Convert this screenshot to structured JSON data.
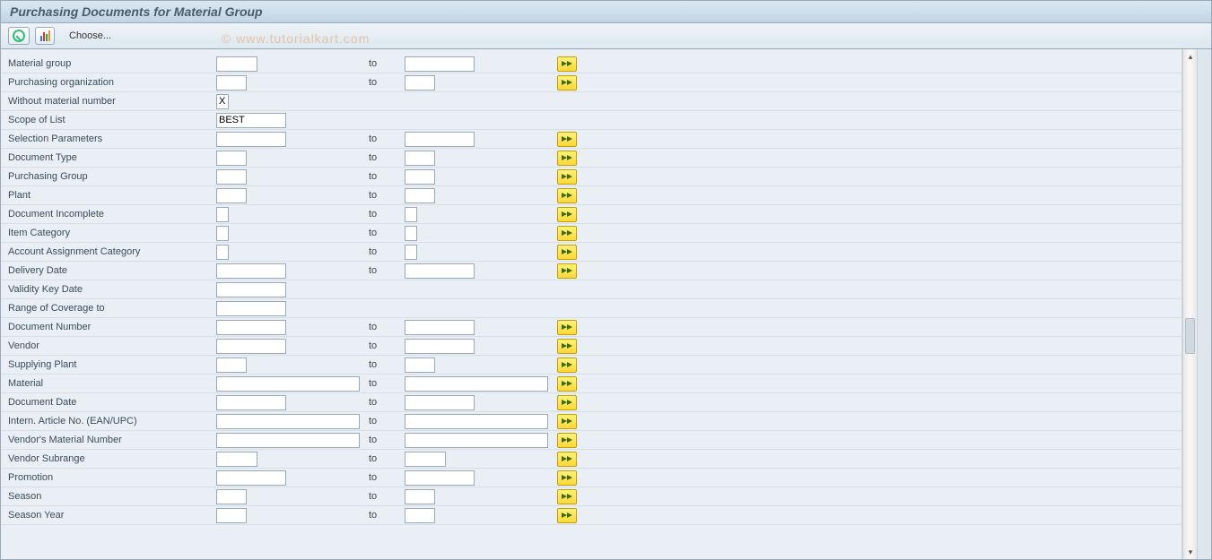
{
  "title": "Purchasing Documents for Material Group",
  "watermark": "© www.tutorialkart.com",
  "toolbar": {
    "choose": "Choose..."
  },
  "to": "to",
  "fields": [
    {
      "id": "material-group",
      "label": "Material group",
      "from_w": "s2",
      "to_w": "md",
      "multi": true,
      "val": ""
    },
    {
      "id": "purch-org",
      "label": "Purchasing organization",
      "from_w": "sm",
      "to_w": "sm",
      "multi": true,
      "val": ""
    },
    {
      "id": "without-mat-no",
      "label": "Without material number",
      "from_w": "xs",
      "to_w": "",
      "multi": false,
      "val": "X"
    },
    {
      "id": "scope-of-list",
      "label": "Scope of List",
      "from_w": "md",
      "to_w": "",
      "multi": false,
      "val": "BEST"
    },
    {
      "id": "selection-params",
      "label": "Selection Parameters",
      "from_w": "md",
      "to_w": "md",
      "multi": true,
      "val": ""
    },
    {
      "id": "doc-type",
      "label": "Document Type",
      "from_w": "sm",
      "to_w": "sm",
      "multi": true,
      "val": ""
    },
    {
      "id": "purch-group",
      "label": "Purchasing Group",
      "from_w": "sm",
      "to_w": "sm",
      "multi": true,
      "val": ""
    },
    {
      "id": "plant",
      "label": "Plant",
      "from_w": "sm",
      "to_w": "sm",
      "multi": true,
      "val": ""
    },
    {
      "id": "doc-incomplete",
      "label": "Document Incomplete",
      "from_w": "xs",
      "to_w": "xs",
      "multi": true,
      "val": ""
    },
    {
      "id": "item-category",
      "label": "Item Category",
      "from_w": "xs",
      "to_w": "xs",
      "multi": true,
      "val": ""
    },
    {
      "id": "acct-assign-cat",
      "label": "Account Assignment Category",
      "from_w": "xs",
      "to_w": "xs",
      "multi": true,
      "val": ""
    },
    {
      "id": "delivery-date",
      "label": "Delivery Date",
      "from_w": "md",
      "to_w": "md",
      "multi": true,
      "val": ""
    },
    {
      "id": "validity-key-date",
      "label": "Validity Key Date",
      "from_w": "md",
      "to_w": "",
      "multi": false,
      "val": ""
    },
    {
      "id": "range-coverage-to",
      "label": "Range of Coverage to",
      "from_w": "md",
      "to_w": "",
      "multi": false,
      "val": ""
    },
    {
      "id": "doc-number",
      "label": "Document Number",
      "from_w": "md",
      "to_w": "md",
      "multi": true,
      "val": ""
    },
    {
      "id": "vendor",
      "label": "Vendor",
      "from_w": "md",
      "to_w": "md",
      "multi": true,
      "val": ""
    },
    {
      "id": "supplying-plant",
      "label": "Supplying Plant",
      "from_w": "sm",
      "to_w": "sm",
      "multi": true,
      "val": ""
    },
    {
      "id": "material",
      "label": "Material",
      "from_w": "lg",
      "to_w": "lg",
      "multi": true,
      "val": ""
    },
    {
      "id": "doc-date",
      "label": "Document Date",
      "from_w": "md",
      "to_w": "md",
      "multi": true,
      "val": ""
    },
    {
      "id": "ean-upc",
      "label": "Intern. Article No. (EAN/UPC)",
      "from_w": "lg",
      "to_w": "lg",
      "multi": true,
      "val": ""
    },
    {
      "id": "vendor-mat-no",
      "label": "Vendor's Material Number",
      "from_w": "lg",
      "to_w": "lg",
      "multi": true,
      "val": ""
    },
    {
      "id": "vendor-subrange",
      "label": "Vendor Subrange",
      "from_w": "s2",
      "to_w": "s2",
      "multi": true,
      "val": ""
    },
    {
      "id": "promotion",
      "label": "Promotion",
      "from_w": "md",
      "to_w": "md",
      "multi": true,
      "val": ""
    },
    {
      "id": "season",
      "label": "Season",
      "from_w": "sm",
      "to_w": "sm",
      "multi": true,
      "val": ""
    },
    {
      "id": "season-year",
      "label": "Season Year",
      "from_w": "sm",
      "to_w": "sm",
      "multi": true,
      "val": ""
    }
  ]
}
